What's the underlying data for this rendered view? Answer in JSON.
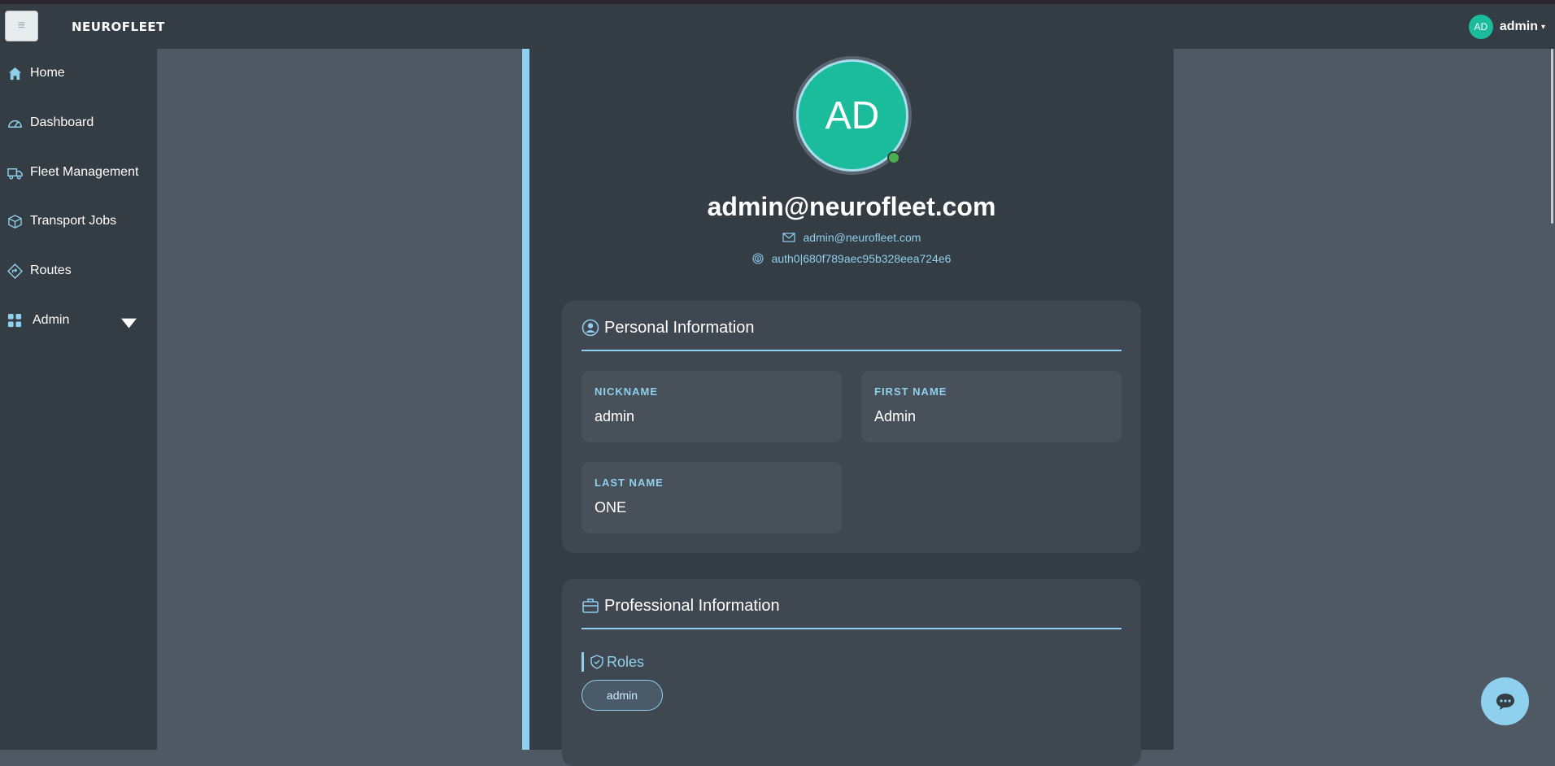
{
  "navbar": {
    "menu_icon": "hamburger-icon",
    "brand": "NEUROFLEET",
    "user": {
      "initials": "AD",
      "name": "admin",
      "caret_icon": "caret-down-icon"
    }
  },
  "sidebar": {
    "items": [
      {
        "label": "Home",
        "icon": "home-icon"
      },
      {
        "label": "Dashboard",
        "icon": "speedometer-icon"
      },
      {
        "label": "Fleet Management",
        "icon": "truck-icon"
      },
      {
        "label": "Transport Jobs",
        "icon": "box-icon"
      },
      {
        "label": "Routes",
        "icon": "signpost-icon"
      },
      {
        "label": "Admin",
        "icon": "grid-icon",
        "caret_icon": "caret-down-icon"
      }
    ]
  },
  "profile": {
    "initials": "AD",
    "title": "admin@neurofleet.com",
    "email": "admin@neurofleet.com",
    "user_id": "auth0|680f789aec95b328eea724e6"
  },
  "personal": {
    "heading": "Personal Information",
    "fields": [
      {
        "label": "NICKNAME",
        "value": "admin"
      },
      {
        "label": "FIRST NAME",
        "value": "Admin"
      },
      {
        "label": "LAST NAME",
        "value": "ONE"
      }
    ]
  },
  "professional": {
    "heading": "Professional Information",
    "roles_label": "Roles",
    "roles": [
      "admin"
    ]
  },
  "colors": {
    "accent": "#8fd0ee",
    "avatar": "#1abc9c",
    "online": "#4caf50",
    "panel": "#343c44",
    "background": "#4f5964"
  }
}
